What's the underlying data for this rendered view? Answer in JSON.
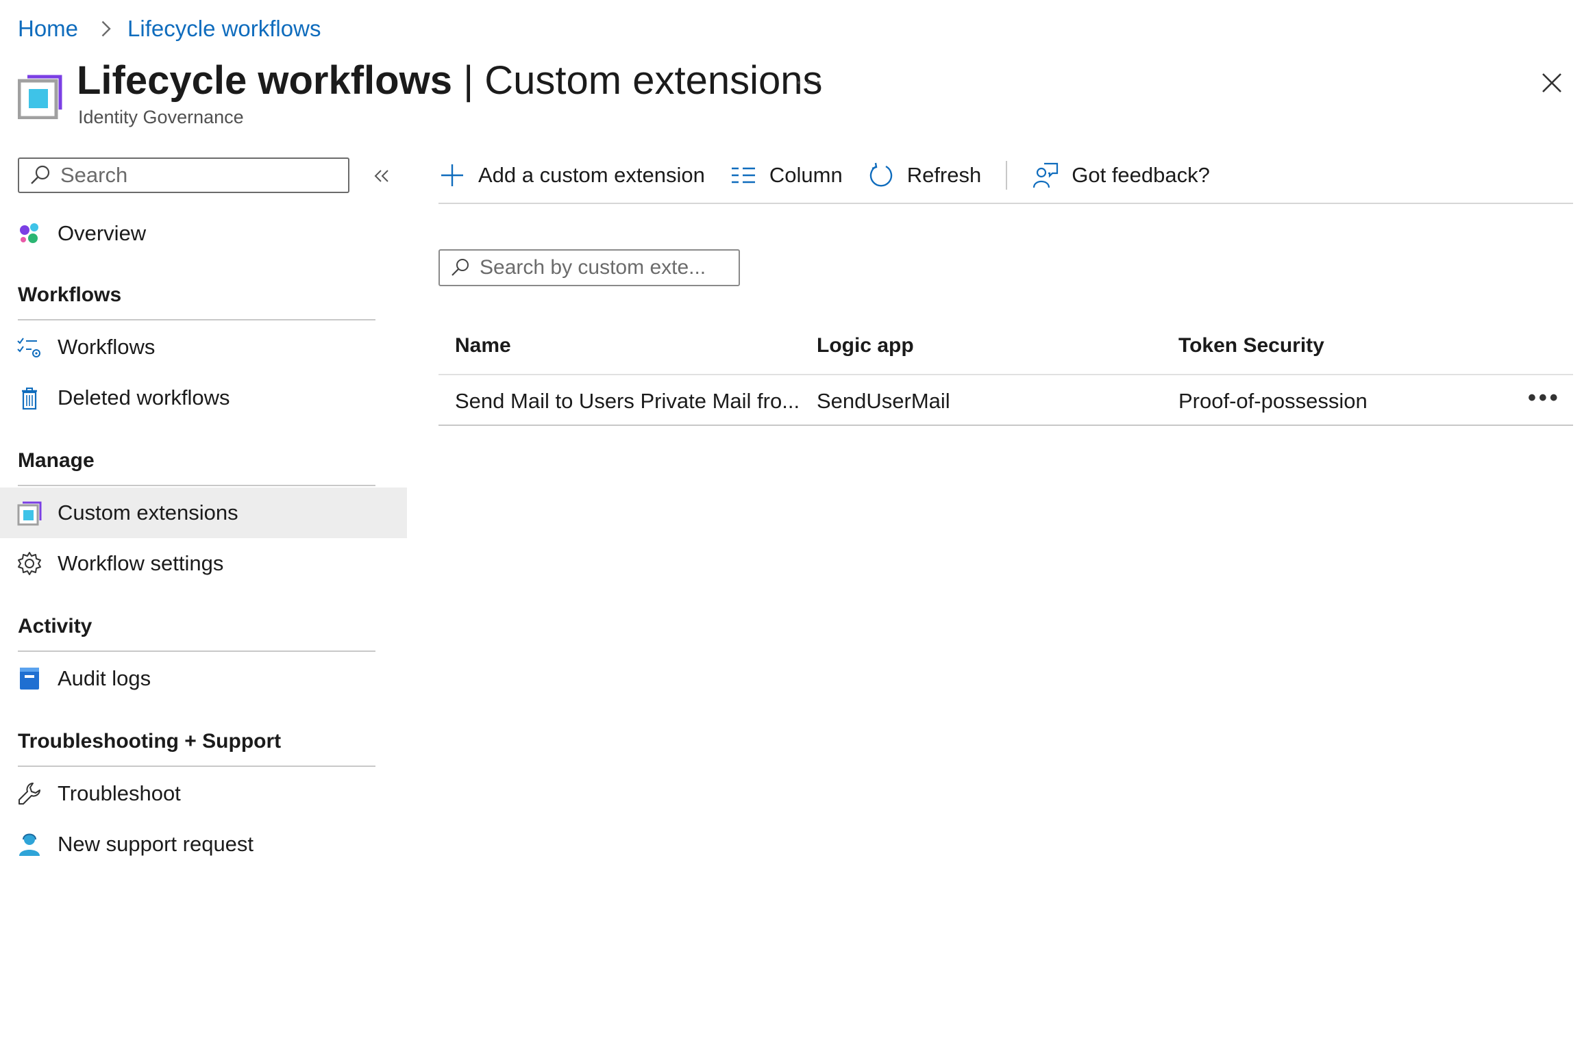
{
  "breadcrumb": {
    "home": "Home",
    "current": "Lifecycle workflows"
  },
  "header": {
    "title_bold": "Lifecycle workflows",
    "title_rest": " | Custom extensions",
    "subtitle": "Identity Governance",
    "more": "···"
  },
  "sidebar": {
    "search_placeholder": "Search",
    "overview": "Overview",
    "sections": {
      "workflows": "Workflows",
      "manage": "Manage",
      "activity": "Activity",
      "support": "Troubleshooting + Support"
    },
    "items": {
      "workflows": "Workflows",
      "deleted_workflows": "Deleted workflows",
      "custom_extensions": "Custom extensions",
      "workflow_settings": "Workflow settings",
      "audit_logs": "Audit logs",
      "troubleshoot": "Troubleshoot",
      "new_support_request": "New support request"
    }
  },
  "toolbar": {
    "add": "Add a custom extension",
    "column": "Column",
    "refresh": "Refresh",
    "feedback": "Got feedback?"
  },
  "filter": {
    "placeholder": "Search by custom exte..."
  },
  "table": {
    "headers": [
      "Name",
      "Logic app",
      "Token Security"
    ],
    "rows": [
      {
        "name": "Send Mail to Users Private Mail fro...",
        "logic_app": "SendUserMail",
        "token_security": "Proof-of-possession",
        "more": "•••"
      }
    ]
  },
  "colors": {
    "link": "#0f6cbd",
    "active_bg": "#ededed",
    "accent_purple": "#7b3fe4",
    "accent_cyan": "#3ec3e8"
  }
}
